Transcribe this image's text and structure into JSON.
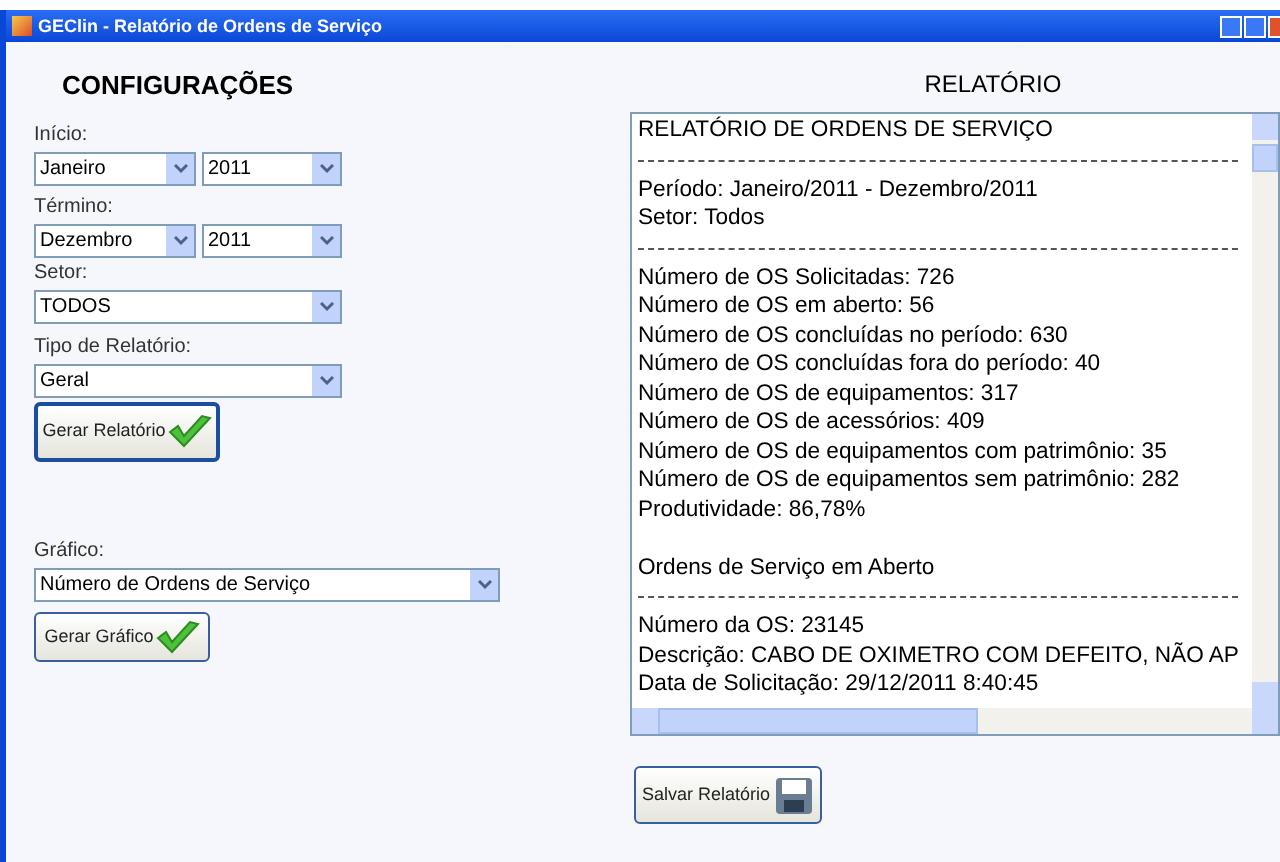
{
  "window": {
    "title": "GEClin - Relatório de Ordens de Serviço"
  },
  "config": {
    "heading": "CONFIGURAÇÕES",
    "inicio": {
      "label": "Início:",
      "month": "Janeiro",
      "year": "2011"
    },
    "termino": {
      "label": "Término:",
      "month": "Dezembro",
      "year": "2011"
    },
    "setor": {
      "label": "Setor:",
      "value": "TODOS"
    },
    "tipo": {
      "label": "Tipo de Relatório:",
      "value": "Geral"
    },
    "report_button": "Gerar Relatório",
    "grafico": {
      "label": "Gráfico:",
      "value": "Número de Ordens de Serviço"
    },
    "chart_button": "Gerar Gráfico"
  },
  "report": {
    "heading": "RELATÓRIO",
    "lines": [
      {
        "kind": "text",
        "text": "RELATÓRIO DE ORDENS DE SERVIÇO"
      },
      {
        "kind": "separator"
      },
      {
        "kind": "text",
        "text": "Período: Janeiro/2011  -  Dezembro/2011"
      },
      {
        "kind": "text",
        "text": "Setor: Todos"
      },
      {
        "kind": "separator"
      },
      {
        "kind": "text",
        "text": "Número de OS Solicitadas: 726"
      },
      {
        "kind": "text",
        "text": "Número de OS em aberto: 56"
      },
      {
        "kind": "text",
        "text": "Número de OS concluídas no período: 630"
      },
      {
        "kind": "text",
        "text": "Número de OS concluídas fora do período: 40"
      },
      {
        "kind": "text",
        "text": "Número de OS de equipamentos: 317"
      },
      {
        "kind": "text",
        "text": "Número de OS de acessórios: 409"
      },
      {
        "kind": "text",
        "text": "Número de OS de equipamentos com patrimônio: 35"
      },
      {
        "kind": "text",
        "text": "Número de OS de equipamentos sem patrimônio: 282"
      },
      {
        "kind": "text",
        "text": "Produtividade: 86,78%"
      },
      {
        "kind": "blank"
      },
      {
        "kind": "text",
        "text": "Ordens de Serviço em Aberto"
      },
      {
        "kind": "separator"
      },
      {
        "kind": "text",
        "text": "Número da OS: 23145"
      },
      {
        "kind": "text",
        "text": "Descrição: CABO DE OXIMETRO COM DEFEITO, NÃO AP"
      },
      {
        "kind": "text",
        "text": "Data de Solicitação: 29/12/2011 8:40:45"
      }
    ],
    "save_button": "Salvar Relatório"
  }
}
